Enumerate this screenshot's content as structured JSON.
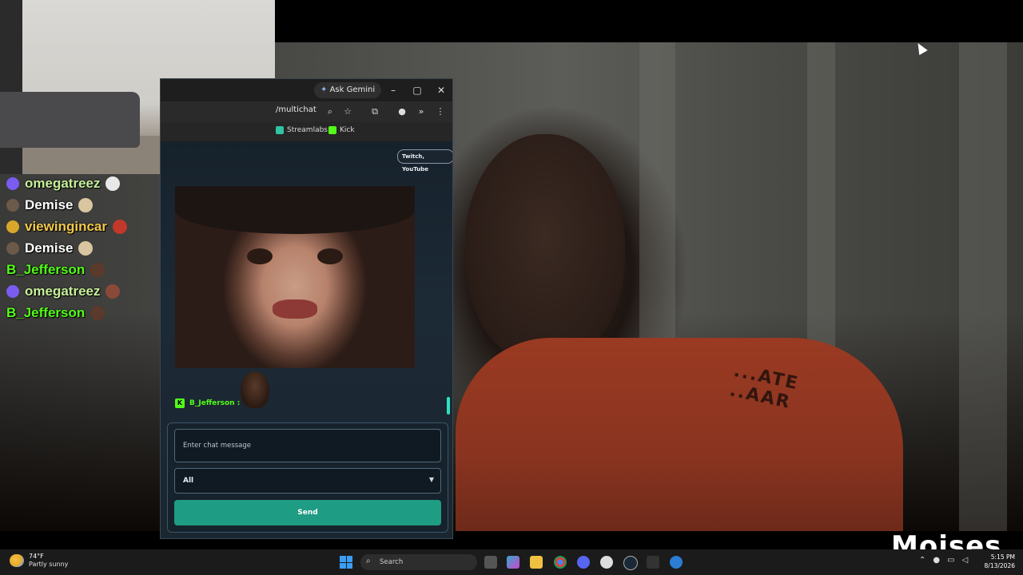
{
  "stream": {
    "watermark": "Moises",
    "hoodie_print": "...ATE\n..AAR"
  },
  "overlay_chat": [
    {
      "user": "omegatreez",
      "name_color": "#c7f09a",
      "badge_color": "#7a5cf0",
      "emote_color": "#e8e8e8"
    },
    {
      "user": "Demise",
      "name_color": "#ffffff",
      "badge_color": "#6b5a4a",
      "emote_color": "#d9c6a0"
    },
    {
      "user": "viewingincar",
      "name_color": "#f2c94c",
      "badge_color": "#d9a72a",
      "emote_color": "#c0392b"
    },
    {
      "user": "Demise",
      "name_color": "#ffffff",
      "badge_color": "#6b5a4a",
      "emote_color": "#d9c6a0"
    },
    {
      "user": "B_Jefferson",
      "name_color": "#53fc18",
      "badge_color": "",
      "emote_color": "#5a3a2a"
    },
    {
      "user": "omegatreez",
      "name_color": "#c7f09a",
      "badge_color": "#7a5cf0",
      "emote_color": "#8a4a3a"
    },
    {
      "user": "B_Jefferson",
      "name_color": "#53fc18",
      "badge_color": "",
      "emote_color": "#5a3a2a"
    }
  ],
  "browser": {
    "ask_gemini_label": "Ask Gemini",
    "url": "/multichat",
    "bookmarks": [
      {
        "label": "Streamlabs",
        "color": "#31c3a2"
      },
      {
        "label": "Kick",
        "color": "#53fc18"
      }
    ]
  },
  "multichat": {
    "platforms_chip": "Twitch, YouTube",
    "last_message_user": "B_Jefferson :",
    "last_message_platform_badge": "K",
    "input_placeholder": "Enter chat message",
    "selected_platform": "All",
    "send_label": "Send"
  },
  "taskbar": {
    "weather_temp": "74°F",
    "weather_desc": "Partly sunny",
    "search_placeholder": "Search",
    "time": "5:15 PM",
    "date": "8/13/2026"
  }
}
